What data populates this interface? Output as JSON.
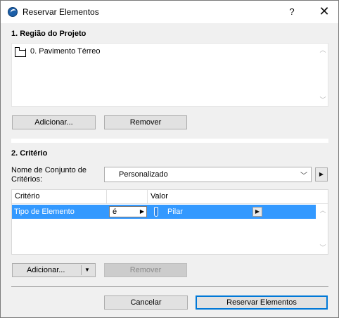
{
  "window": {
    "title": "Reservar Elementos",
    "help_glyph": "?",
    "close_glyph": "✕"
  },
  "section1": {
    "label": "1. Região do Projeto",
    "items": [
      {
        "label": "0. Pavimento Térreo",
        "icon": "floor-plan-icon"
      }
    ],
    "add_button": "Adicionar...",
    "remove_button": "Remover"
  },
  "section2": {
    "label": "2. Critério",
    "criteria_set_label_line1": "Nome de Conjunto de",
    "criteria_set_label_line2": "Critérios:",
    "criteria_set_value": "Personalizado",
    "columns": {
      "criterion": "Critério",
      "value": "Valor"
    },
    "rows": [
      {
        "criterion": "Tipo de Elemento",
        "operator": "é",
        "value": "Pilar",
        "icon": "column-element-icon",
        "selected": true
      }
    ],
    "add_button": "Adicionar...",
    "remove_button": "Remover",
    "remove_disabled": true
  },
  "footer": {
    "cancel_button": "Cancelar",
    "ok_button": "Reservar Elementos"
  },
  "colors": {
    "selection": "#3399ff",
    "primary_border": "#0078d7",
    "app_icon": "#1c5fa8"
  }
}
